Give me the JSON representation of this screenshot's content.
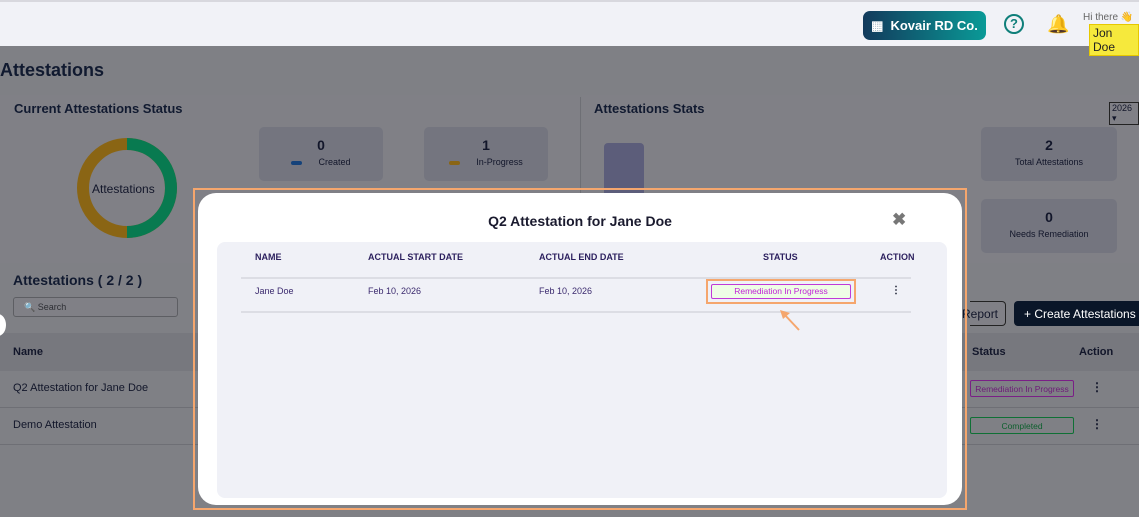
{
  "header": {
    "company": "Kovair RD Co.",
    "greeting": "Hi there 👋",
    "user": "Jon Doe",
    "icons": [
      "building-icon",
      "help-icon",
      "bell-icon"
    ]
  },
  "page": {
    "title": "Attestations"
  },
  "status": {
    "title": "Current  Attestations  Status",
    "donut_label": "Attestations",
    "created": {
      "count": "0",
      "label": "Created"
    },
    "in_progress": {
      "count": "1",
      "label": "In-Progress"
    },
    "colors": {
      "created": "#1e5aa8",
      "in_progress": "#c8951a",
      "completed": "#0a9a62"
    }
  },
  "stats": {
    "title": "Attestations Stats",
    "year": "2026",
    "total": {
      "count": "2",
      "label": "Total  Attestations"
    },
    "needs": {
      "count": "0",
      "label": "Needs Remediation"
    }
  },
  "list": {
    "title": "Attestations ( 2 / 2 )",
    "search_placeholder": "Search",
    "report": "Report",
    "create": "+ Create Attestations",
    "col_name": "Name",
    "col_status": "Status",
    "col_action": "Action",
    "rows": [
      {
        "name": "Q2 Attestation for Jane Doe",
        "status": "Remediation In Progress"
      },
      {
        "name": "Demo Attestation",
        "status": "Completed"
      }
    ]
  },
  "modal": {
    "title": "Q2 Attestation for Jane Doe",
    "columns": [
      "NAME",
      "ACTUAL START DATE",
      "ACTUAL END DATE",
      "STATUS",
      "ACTION"
    ],
    "rows": [
      {
        "name": "Jane Doe",
        "start": "Feb 10, 2026",
        "end": "Feb 10, 2026",
        "status": "Remediation In Progress"
      }
    ]
  }
}
